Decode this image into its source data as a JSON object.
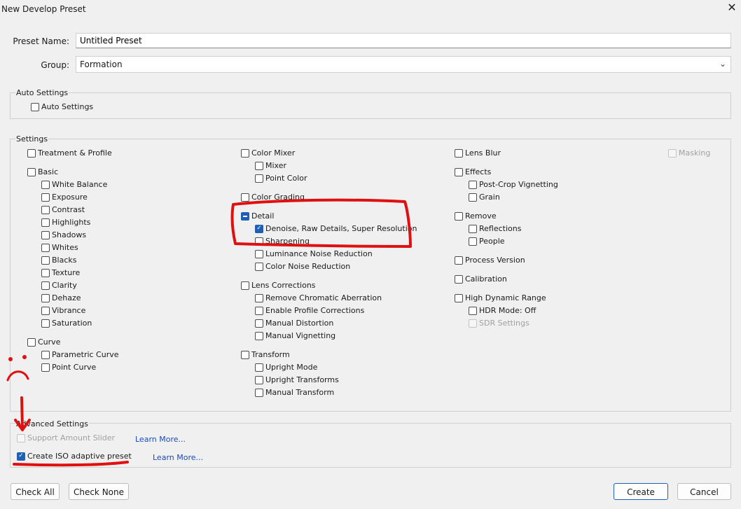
{
  "window": {
    "title": "New Develop Preset",
    "close_label": "✕"
  },
  "preset_name": {
    "label": "Preset Name:",
    "value": "Untitled Preset"
  },
  "group": {
    "label": "Group:",
    "value": "Formation"
  },
  "auto_settings": {
    "title": "Auto Settings",
    "checkbox": {
      "label": "Auto Settings",
      "state": "unchecked"
    }
  },
  "settings": {
    "title": "Settings",
    "items": [
      {
        "id": "treatment-profile",
        "label": "Treatment & Profile",
        "state": "unchecked",
        "col": 0,
        "row": 0,
        "indent": 0
      },
      {
        "id": "basic",
        "label": "Basic",
        "state": "unchecked",
        "col": 0,
        "row": 1.5,
        "indent": 0
      },
      {
        "id": "white-balance",
        "label": "White Balance",
        "state": "unchecked",
        "col": 0,
        "row": 2.5,
        "indent": 1
      },
      {
        "id": "exposure",
        "label": "Exposure",
        "state": "unchecked",
        "col": 0,
        "row": 3.5,
        "indent": 1
      },
      {
        "id": "contrast",
        "label": "Contrast",
        "state": "unchecked",
        "col": 0,
        "row": 4.5,
        "indent": 1
      },
      {
        "id": "highlights",
        "label": "Highlights",
        "state": "unchecked",
        "col": 0,
        "row": 5.5,
        "indent": 1
      },
      {
        "id": "shadows",
        "label": "Shadows",
        "state": "unchecked",
        "col": 0,
        "row": 6.5,
        "indent": 1
      },
      {
        "id": "whites",
        "label": "Whites",
        "state": "unchecked",
        "col": 0,
        "row": 7.5,
        "indent": 1
      },
      {
        "id": "blacks",
        "label": "Blacks",
        "state": "unchecked",
        "col": 0,
        "row": 8.5,
        "indent": 1
      },
      {
        "id": "texture",
        "label": "Texture",
        "state": "unchecked",
        "col": 0,
        "row": 9.5,
        "indent": 1
      },
      {
        "id": "clarity",
        "label": "Clarity",
        "state": "unchecked",
        "col": 0,
        "row": 10.5,
        "indent": 1
      },
      {
        "id": "dehaze",
        "label": "Dehaze",
        "state": "unchecked",
        "col": 0,
        "row": 11.5,
        "indent": 1
      },
      {
        "id": "vibrance",
        "label": "Vibrance",
        "state": "unchecked",
        "col": 0,
        "row": 12.5,
        "indent": 1
      },
      {
        "id": "saturation",
        "label": "Saturation",
        "state": "unchecked",
        "col": 0,
        "row": 13.5,
        "indent": 1
      },
      {
        "id": "curve",
        "label": "Curve",
        "state": "unchecked",
        "col": 0,
        "row": 15,
        "indent": 0
      },
      {
        "id": "parametric-curve",
        "label": "Parametric Curve",
        "state": "unchecked",
        "col": 0,
        "row": 16,
        "indent": 1
      },
      {
        "id": "point-curve",
        "label": "Point Curve",
        "state": "unchecked",
        "col": 0,
        "row": 17,
        "indent": 1
      },
      {
        "id": "color-mixer",
        "label": "Color Mixer",
        "state": "unchecked",
        "col": 1,
        "row": 0,
        "indent": 0
      },
      {
        "id": "mixer",
        "label": "Mixer",
        "state": "unchecked",
        "col": 1,
        "row": 1,
        "indent": 1
      },
      {
        "id": "point-color",
        "label": "Point Color",
        "state": "unchecked",
        "col": 1,
        "row": 2,
        "indent": 1
      },
      {
        "id": "color-grading",
        "label": "Color Grading",
        "state": "unchecked",
        "col": 1,
        "row": 3.5,
        "indent": 0
      },
      {
        "id": "detail",
        "label": "Detail",
        "state": "mixed",
        "col": 1,
        "row": 5,
        "indent": 0
      },
      {
        "id": "denoise",
        "label": "Denoise, Raw Details, Super Resolution",
        "state": "checked",
        "col": 1,
        "row": 6,
        "indent": 1
      },
      {
        "id": "sharpening",
        "label": "Sharpening",
        "state": "unchecked",
        "col": 1,
        "row": 7,
        "indent": 1
      },
      {
        "id": "luminance-nr",
        "label": "Luminance Noise Reduction",
        "state": "unchecked",
        "col": 1,
        "row": 8,
        "indent": 1
      },
      {
        "id": "color-nr",
        "label": "Color Noise Reduction",
        "state": "unchecked",
        "col": 1,
        "row": 9,
        "indent": 1
      },
      {
        "id": "lens-corrections",
        "label": "Lens Corrections",
        "state": "unchecked",
        "col": 1,
        "row": 10.5,
        "indent": 0
      },
      {
        "id": "remove-ca",
        "label": "Remove Chromatic Aberration",
        "state": "unchecked",
        "col": 1,
        "row": 11.5,
        "indent": 1
      },
      {
        "id": "profile-corrections",
        "label": "Enable Profile Corrections",
        "state": "unchecked",
        "col": 1,
        "row": 12.5,
        "indent": 1
      },
      {
        "id": "manual-distortion",
        "label": "Manual Distortion",
        "state": "unchecked",
        "col": 1,
        "row": 13.5,
        "indent": 1
      },
      {
        "id": "manual-vignetting",
        "label": "Manual Vignetting",
        "state": "unchecked",
        "col": 1,
        "row": 14.5,
        "indent": 1
      },
      {
        "id": "transform",
        "label": "Transform",
        "state": "unchecked",
        "col": 1,
        "row": 16,
        "indent": 0
      },
      {
        "id": "upright-mode",
        "label": "Upright Mode",
        "state": "unchecked",
        "col": 1,
        "row": 17,
        "indent": 1
      },
      {
        "id": "upright-transforms",
        "label": "Upright Transforms",
        "state": "unchecked",
        "col": 1,
        "row": 18,
        "indent": 1
      },
      {
        "id": "manual-transform",
        "label": "Manual Transform",
        "state": "unchecked",
        "col": 1,
        "row": 19,
        "indent": 1
      },
      {
        "id": "lens-blur",
        "label": "Lens Blur",
        "state": "unchecked",
        "col": 2,
        "row": 0,
        "indent": 0
      },
      {
        "id": "effects",
        "label": "Effects",
        "state": "unchecked",
        "col": 2,
        "row": 1.5,
        "indent": 0
      },
      {
        "id": "post-crop-vignetting",
        "label": "Post-Crop Vignetting",
        "state": "unchecked",
        "col": 2,
        "row": 2.5,
        "indent": 1
      },
      {
        "id": "grain",
        "label": "Grain",
        "state": "unchecked",
        "col": 2,
        "row": 3.5,
        "indent": 1
      },
      {
        "id": "remove",
        "label": "Remove",
        "state": "unchecked",
        "col": 2,
        "row": 5,
        "indent": 0
      },
      {
        "id": "reflections",
        "label": "Reflections",
        "state": "unchecked",
        "col": 2,
        "row": 6,
        "indent": 1
      },
      {
        "id": "people",
        "label": "People",
        "state": "unchecked",
        "col": 2,
        "row": 7,
        "indent": 1
      },
      {
        "id": "process-version",
        "label": "Process Version",
        "state": "unchecked",
        "col": 2,
        "row": 8.5,
        "indent": 0
      },
      {
        "id": "calibration",
        "label": "Calibration",
        "state": "unchecked",
        "col": 2,
        "row": 10,
        "indent": 0
      },
      {
        "id": "high-dynamic-range",
        "label": "High Dynamic Range",
        "state": "unchecked",
        "col": 2,
        "row": 11.5,
        "indent": 0
      },
      {
        "id": "hdr-mode",
        "label": "HDR Mode: Off",
        "state": "unchecked",
        "col": 2,
        "row": 12.5,
        "indent": 1
      },
      {
        "id": "sdr-settings",
        "label": "SDR Settings",
        "state": "disabled",
        "col": 2,
        "row": 13.5,
        "indent": 1
      },
      {
        "id": "masking",
        "label": "Masking",
        "state": "disabled",
        "col": 3,
        "row": 0,
        "indent": 0
      }
    ]
  },
  "advanced_settings": {
    "title": "Advanced Settings",
    "support_amount_slider": {
      "label": "Support Amount Slider",
      "state": "disabled",
      "link": "Learn More..."
    },
    "iso_adaptive": {
      "label": "Create ISO adaptive preset",
      "state": "checked",
      "link": "Learn More..."
    }
  },
  "buttons": {
    "check_all": "Check All",
    "check_none": "Check None",
    "create": "Create",
    "cancel": "Cancel"
  },
  "colors": {
    "accent": "#1f5fb6",
    "annotation": "#e01010",
    "link": "#1a4bb7"
  }
}
